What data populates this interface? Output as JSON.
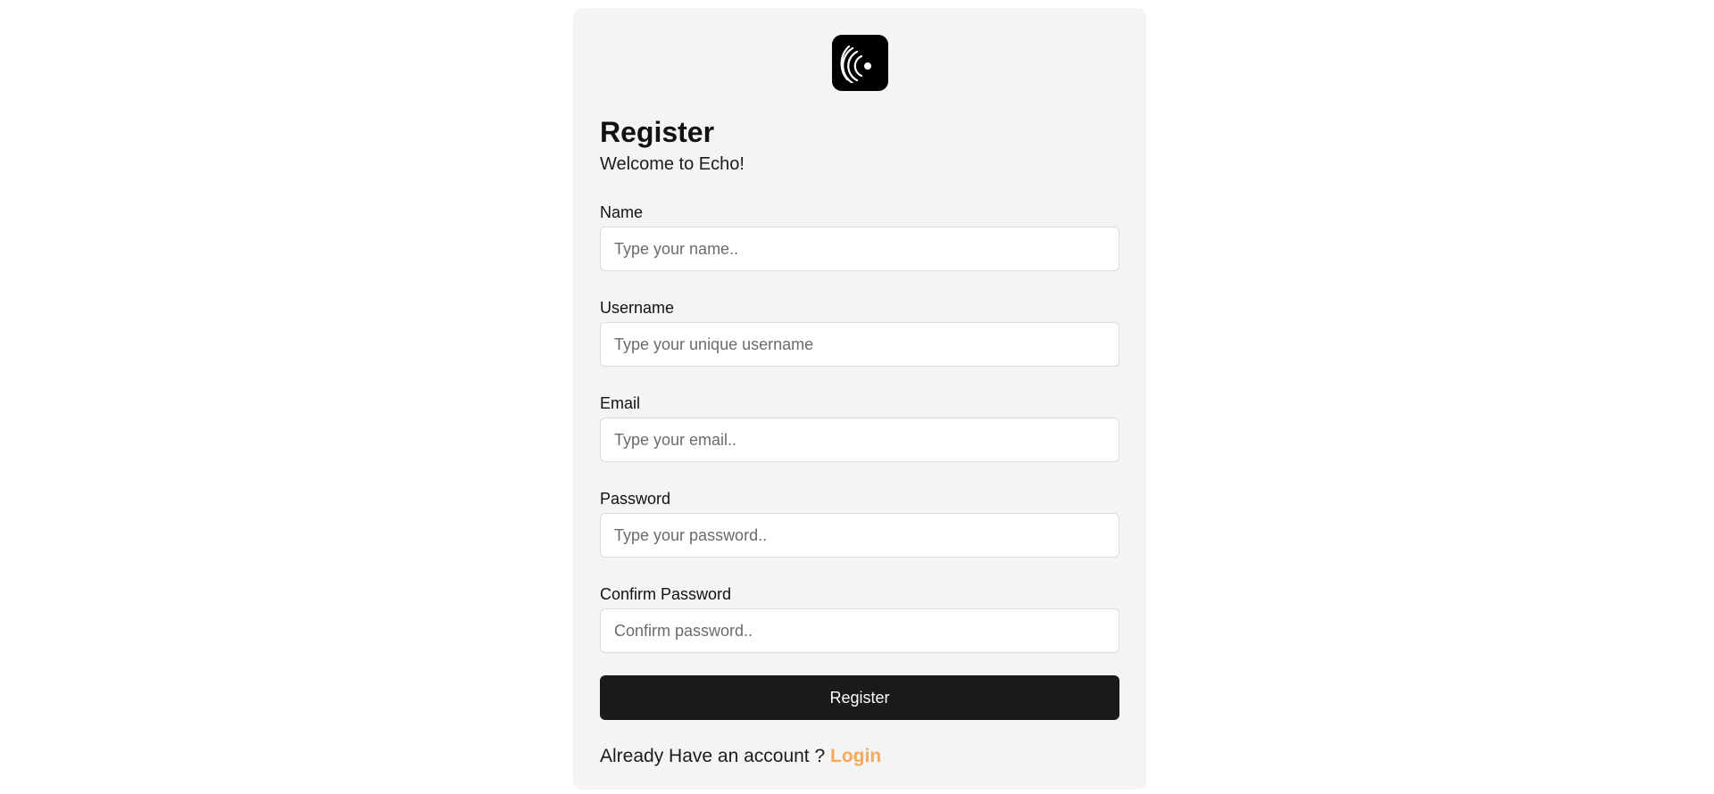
{
  "app": {
    "logo_icon": "echo-signal-icon",
    "accent_color": "#f6a85a"
  },
  "header": {
    "title": "Register",
    "subtitle": "Welcome to Echo!"
  },
  "form": {
    "fields": [
      {
        "label": "Name",
        "placeholder": "Type your name..",
        "value": ""
      },
      {
        "label": "Username",
        "placeholder": "Type your unique username",
        "value": ""
      },
      {
        "label": "Email",
        "placeholder": "Type your email..",
        "value": ""
      },
      {
        "label": "Password",
        "placeholder": "Type your password..",
        "value": ""
      },
      {
        "label": "Confirm Password",
        "placeholder": "Confirm password..",
        "value": ""
      }
    ],
    "submit_label": "Register"
  },
  "footer": {
    "prompt_text": "Already Have an account ? ",
    "login_label": "Login"
  }
}
